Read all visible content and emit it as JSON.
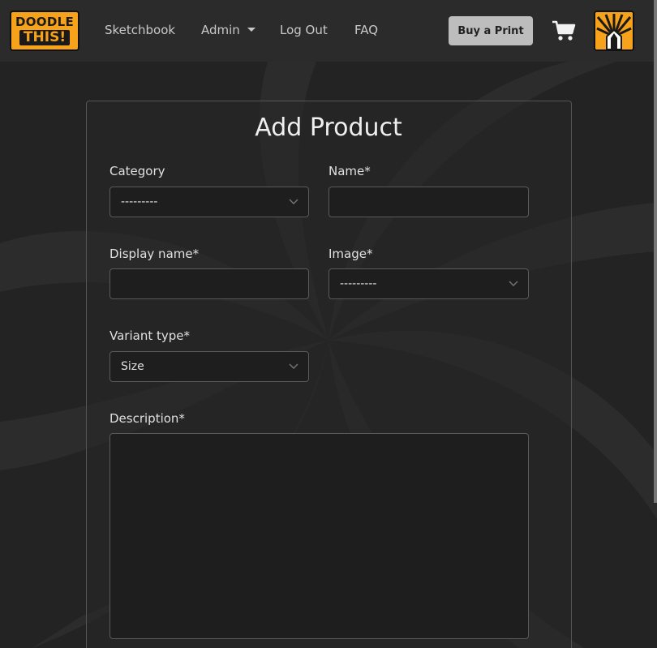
{
  "nav": {
    "logo_line1": "DOODLE",
    "logo_line2": "THIS!",
    "links": [
      "Sketchbook",
      "Admin",
      "Log Out",
      "FAQ"
    ],
    "buy_label": "Buy a Print"
  },
  "form": {
    "title": "Add Product",
    "category": {
      "label": "Category",
      "value": "---------"
    },
    "name": {
      "label": "Name*",
      "value": ""
    },
    "display_name": {
      "label": "Display name*",
      "value": ""
    },
    "image": {
      "label": "Image*",
      "value": "---------"
    },
    "variant_type": {
      "label": "Variant type*",
      "value": "Size"
    },
    "description": {
      "label": "Description*",
      "value": ""
    }
  },
  "colors": {
    "brand": "#f7a21b",
    "navbar": "#2b2b2b",
    "background": "#232323",
    "button": "#bdbdbd"
  },
  "icons": [
    "cart-icon",
    "sunburst-pencil-icon",
    "chevron-down-icon",
    "caret-down-icon"
  ]
}
